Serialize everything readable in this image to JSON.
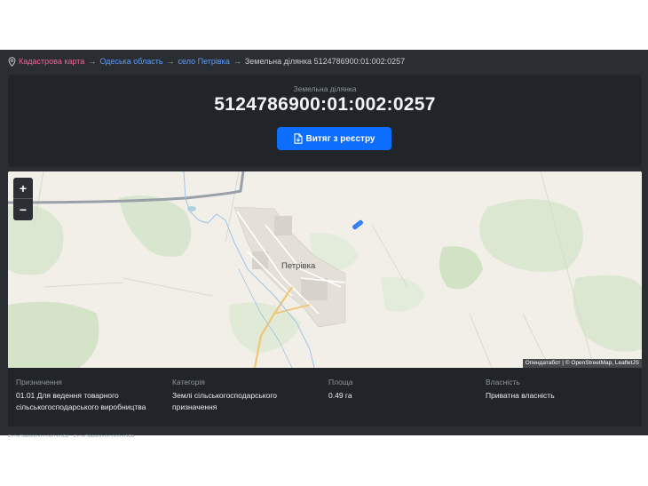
{
  "breadcrumb": {
    "items": [
      "Кадастрова карта",
      "Одеська область",
      "село Петрівка",
      "Земельна ділянка 5124786900:01:002:0257"
    ],
    "separator": "→"
  },
  "header": {
    "subtitle": "Земельна ділянка",
    "cadastral_number": "5124786900:01:002:0257",
    "extract_button": "Витяг з реєстру"
  },
  "map": {
    "zoom_in": "+",
    "zoom_out": "−",
    "place_label": "Петрівка",
    "attribution_prefix": "Опендатабот | © ",
    "attribution_links": "OpenStreetMap, LeafletJS",
    "parcel_color": "#0d6efd"
  },
  "details": {
    "purpose": {
      "label": "Призначення",
      "value": "01.01 Для ведення товарного сільськогосподарського виробництва"
    },
    "category": {
      "label": "Категорія",
      "value": "Землі сільськогосподарського призначення"
    },
    "area": {
      "label": "Площа",
      "value": "0.49 га"
    },
    "ownership": {
      "label": "Власність",
      "value": "Приватна власність"
    }
  },
  "neighbors": "5124786900:01:002:0256 · 5124786900:01:002:0258",
  "colors": {
    "accent": "#0d6efd",
    "breadcrumb_root": "#f06292",
    "breadcrumb_link": "#5b9bff",
    "panel": "#212529"
  }
}
